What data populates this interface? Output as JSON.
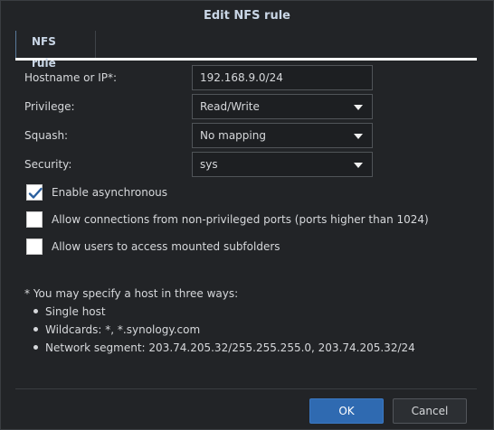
{
  "dialog": {
    "title": "Edit NFS rule",
    "tabs": [
      {
        "label": "NFS rule",
        "active": true
      }
    ]
  },
  "form": {
    "hostname": {
      "label": "Hostname or IP*:",
      "value": "192.168.9.0/24"
    },
    "privilege": {
      "label": "Privilege:",
      "value": "Read/Write"
    },
    "squash": {
      "label": "Squash:",
      "value": "No mapping"
    },
    "security": {
      "label": "Security:",
      "value": "sys"
    }
  },
  "options": [
    {
      "label": "Enable asynchronous",
      "checked": true
    },
    {
      "label": "Allow connections from non-privileged ports (ports higher than 1024)",
      "checked": false
    },
    {
      "label": "Allow users to access mounted subfolders",
      "checked": false
    }
  ],
  "note": {
    "heading": "* You may specify a host in three ways:",
    "items": [
      "Single host",
      "Wildcards: *, *.synology.com",
      "Network segment: 203.74.205.32/255.255.255.0, 203.74.205.32/24"
    ]
  },
  "buttons": {
    "ok": "OK",
    "cancel": "Cancel"
  },
  "colors": {
    "background": "#222427",
    "accent": "#2f6ab1",
    "checkmark": "#2a5f9e"
  }
}
